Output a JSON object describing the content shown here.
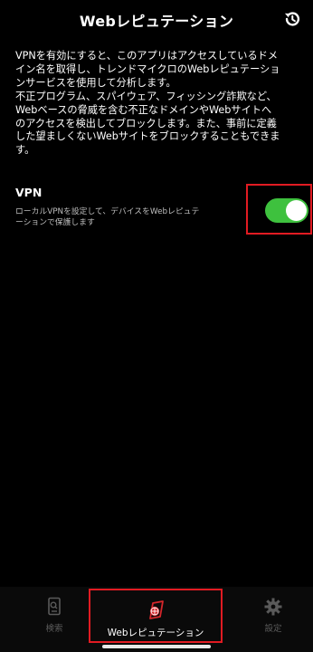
{
  "header": {
    "title": "Webレピュテーション",
    "history_icon": "history-icon"
  },
  "description": "VPNを有効にすると、このアプリはアクセスしているドメ\nイン名を取得し、トレンドマイクロのWebレピュテーショ\nンサービスを使用して分析します。\n不正プログラム、スパイウェア、フィッシング詐欺など、\nWebベースの脅威を含む不正なドメインやWebサイトへ\nのアクセスを検出してブロックします。また、事前に定義\nした望ましくないWebサイトをブロックすることもできま\nす。",
  "vpn": {
    "title": "VPN",
    "subtitle": "ローカルVPNを設定して、デバイスをWebレピュテ\nーションで保護します",
    "enabled": true,
    "toggle_color": "#3ec13e"
  },
  "tabbar": {
    "items": [
      {
        "label": "検索",
        "icon": "search-phone-icon",
        "active": false
      },
      {
        "label": "Webレピュテーション",
        "icon": "web-reputation-icon",
        "active": true
      },
      {
        "label": "設定",
        "icon": "gear-icon",
        "active": false
      }
    ]
  },
  "colors": {
    "background": "#000000",
    "highlight": "#e11b22",
    "accent_red": "#d6262b"
  }
}
